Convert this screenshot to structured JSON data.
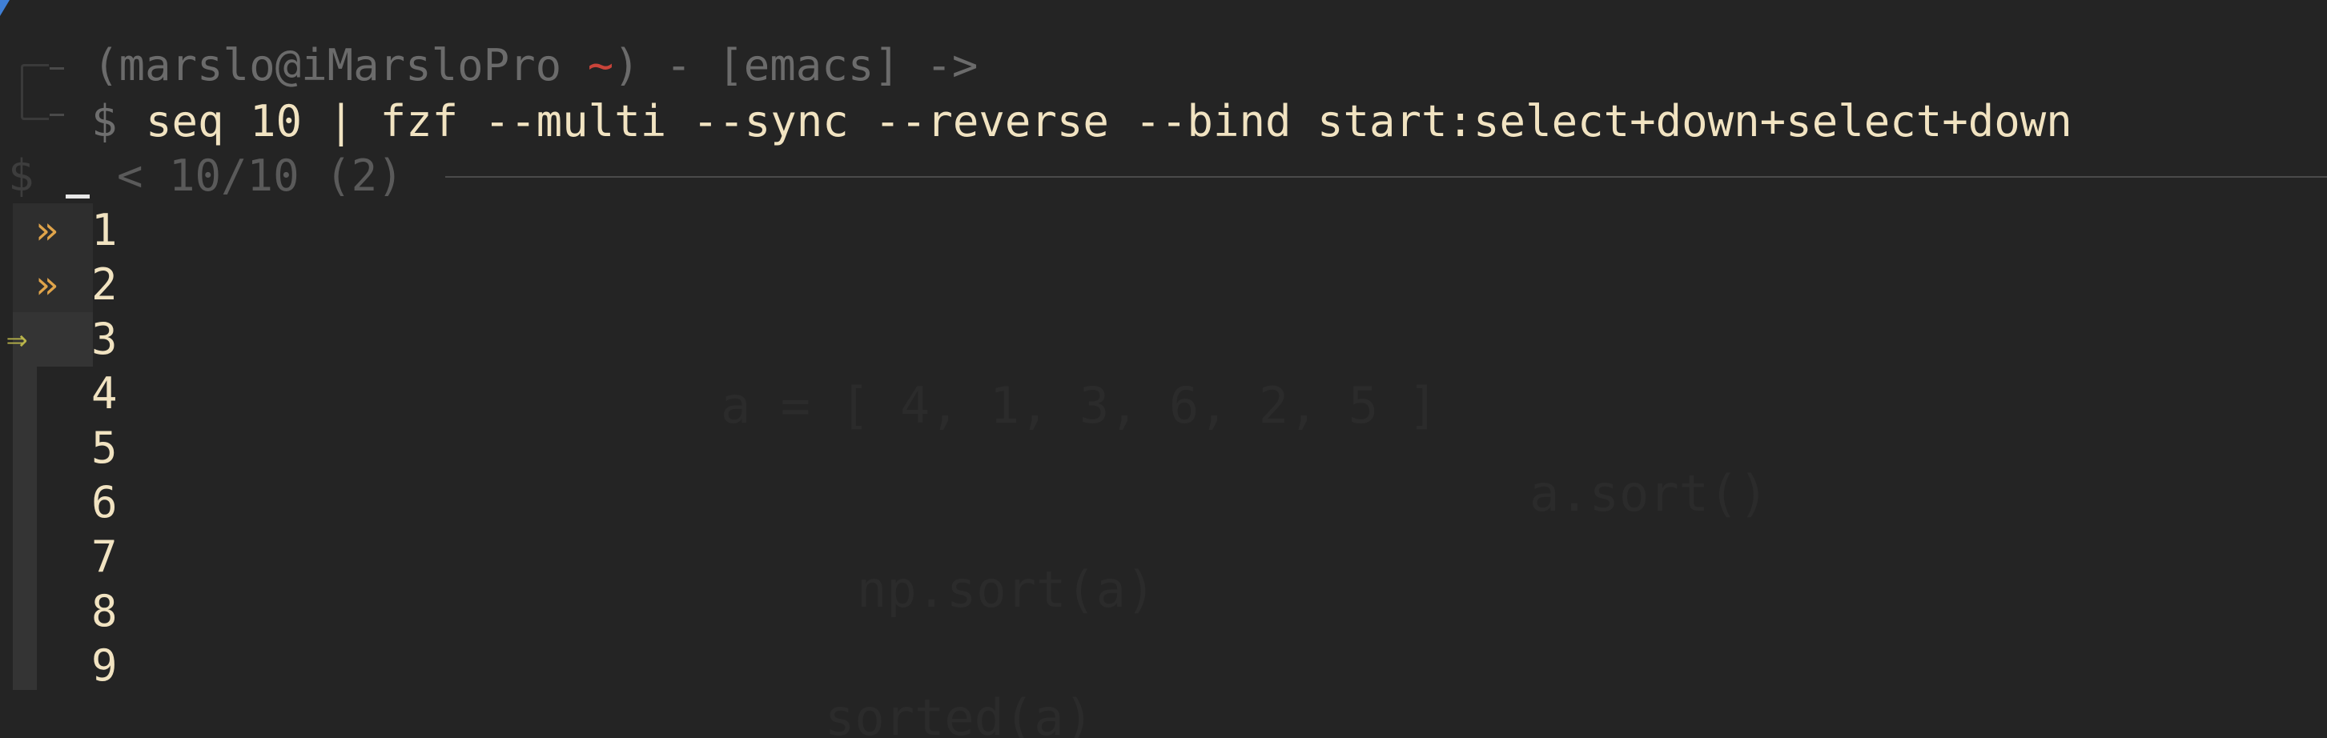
{
  "prompt": {
    "prefix": "(marslo@iMarsloPro ",
    "tilde": "~",
    "suffix": ") - [emacs] ->"
  },
  "command": {
    "dollar": "$",
    "text": "seq 10 | fzf --multi --sync --reverse --bind start:select+down+select+down"
  },
  "fzf": {
    "prompt_symbol": "$",
    "info": "< 10/10 (2)",
    "pointer": "⇒",
    "marker": "»",
    "items": [
      {
        "label": "1",
        "selected": true,
        "current": false
      },
      {
        "label": "2",
        "selected": true,
        "current": false
      },
      {
        "label": "3",
        "selected": false,
        "current": true
      },
      {
        "label": "4",
        "selected": false,
        "current": false
      },
      {
        "label": "5",
        "selected": false,
        "current": false
      },
      {
        "label": "6",
        "selected": false,
        "current": false
      },
      {
        "label": "7",
        "selected": false,
        "current": false
      },
      {
        "label": "8",
        "selected": false,
        "current": false
      },
      {
        "label": "9",
        "selected": false,
        "current": false
      }
    ]
  },
  "background_watermark": {
    "line1": "a = [ 4, 1, 3, 6, 2, 5 ]",
    "line2": "a.sort()",
    "line3": "np.sort(a)",
    "line4": "sorted(a)"
  },
  "colors": {
    "background": "#242424",
    "text": "#f1e3c1",
    "dim": "#6b6b6b",
    "tilde": "#c9443a",
    "marker": "#e0a44a",
    "pointer": "#b9b44a"
  }
}
